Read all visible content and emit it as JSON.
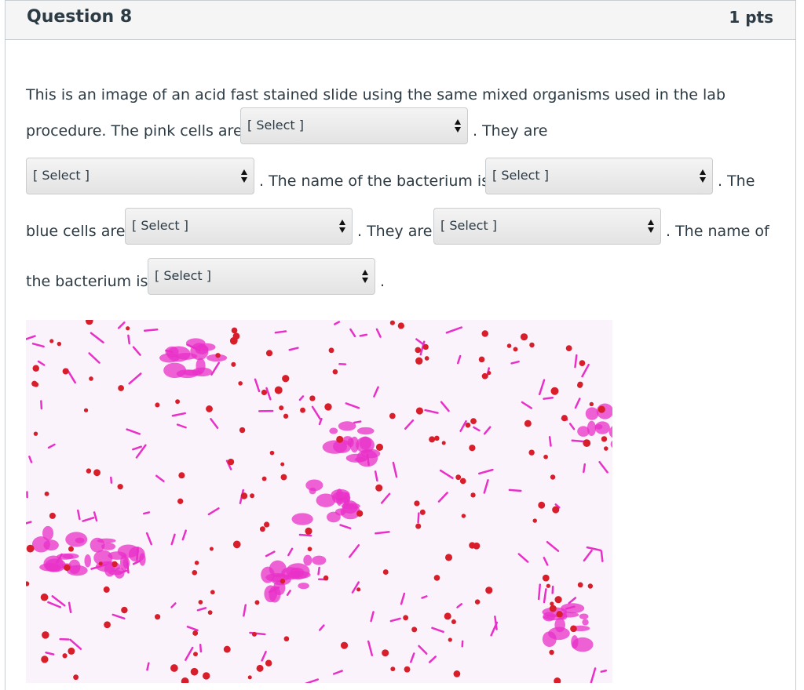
{
  "question": {
    "title": "Question 8",
    "points": "1 pts"
  },
  "text": {
    "line1": "This is an image of an acid fast stained slide using the same mixed organisms used in the lab",
    "line2a": "procedure. The pink cells are",
    "line2b": ". They are",
    "line3a": ". The name of the bacterium is",
    "line3b": ". The",
    "line4a": "blue cells are",
    "line4b": ". They are",
    "line4c": ". The name of",
    "line5a": "the bacterium is",
    "line5b": "."
  },
  "dropdowns": [
    {
      "selected": "[ Select ]"
    },
    {
      "selected": "[ Select ]"
    },
    {
      "selected": "[ Select ]"
    },
    {
      "selected": "[ Select ]"
    },
    {
      "selected": "[ Select ]"
    },
    {
      "selected": "[ Select ]"
    }
  ],
  "colors": {
    "slide_background": "#fbf3fb",
    "stain_pink": "#e830c8",
    "stain_red": "#d81e2a"
  }
}
